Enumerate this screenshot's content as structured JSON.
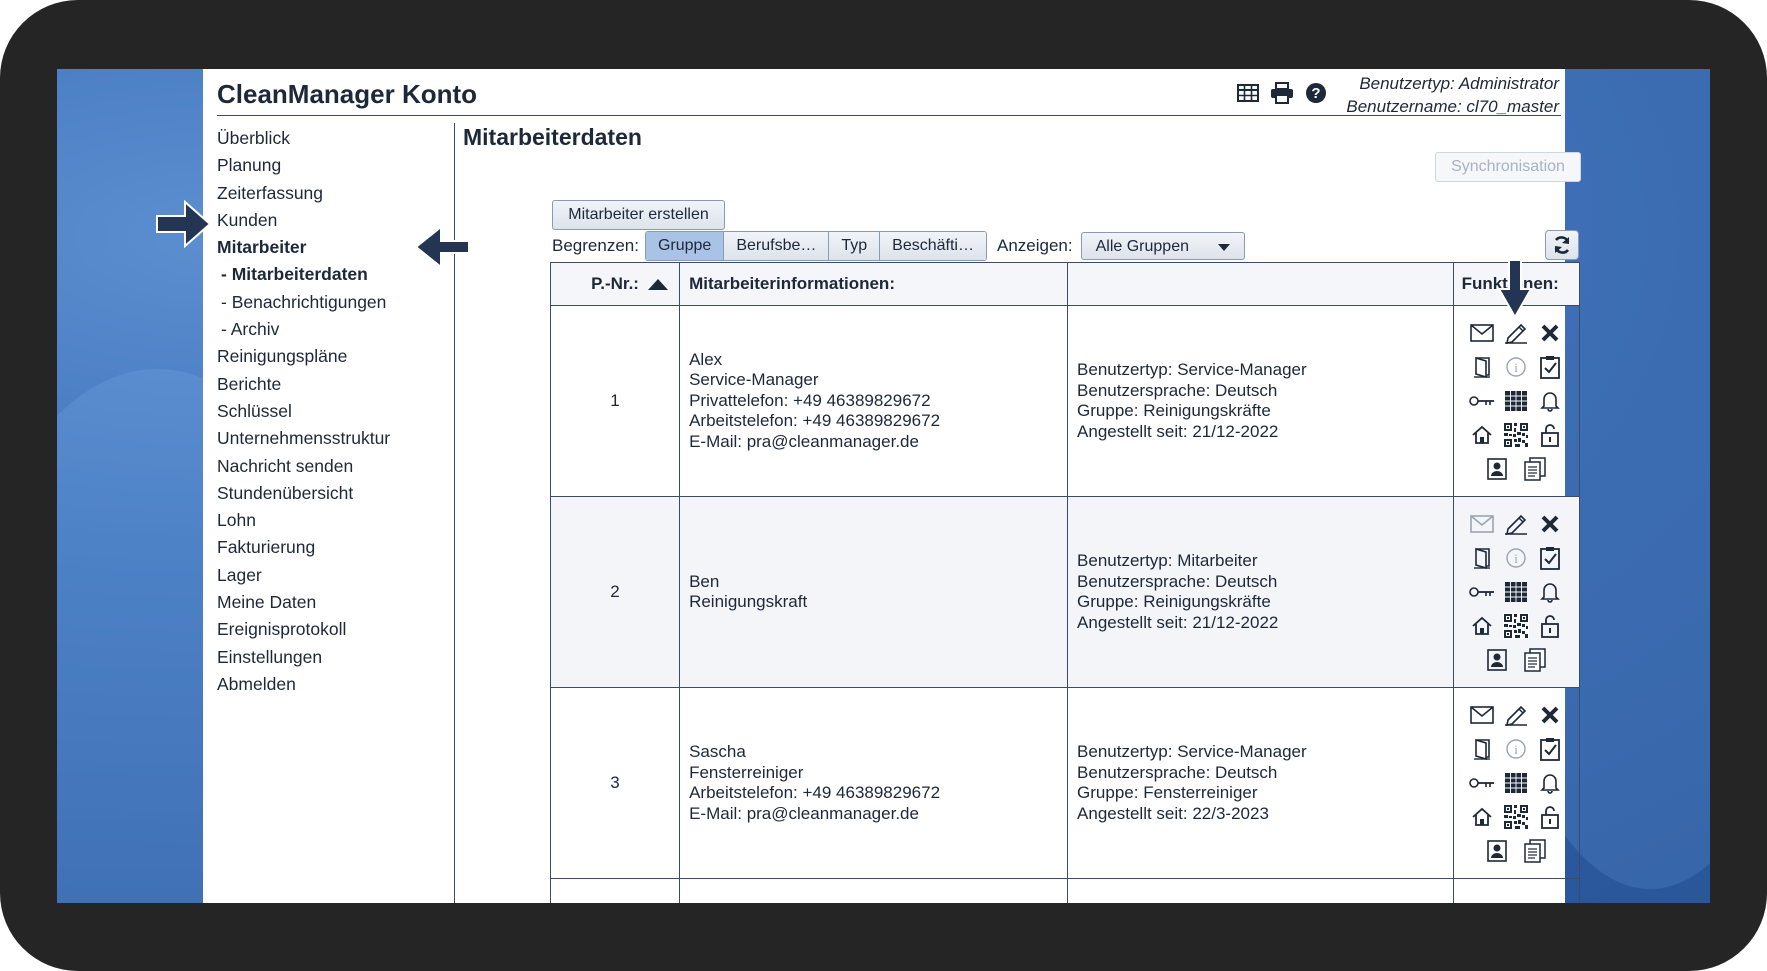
{
  "app": {
    "title": "CleanManager Konto",
    "user_type": "Benutzertyp: Administrator",
    "user_name": "Benutzername: cl70_master"
  },
  "header_icons": [
    "table-icon",
    "print-icon",
    "help-icon"
  ],
  "sidebar": {
    "items": [
      {
        "label": "Überblick",
        "bold": false,
        "sub": false
      },
      {
        "label": "Planung",
        "bold": false,
        "sub": false
      },
      {
        "label": "Zeiterfassung",
        "bold": false,
        "sub": false
      },
      {
        "label": "Kunden",
        "bold": false,
        "sub": false
      },
      {
        "label": "Mitarbeiter",
        "bold": true,
        "sub": false
      },
      {
        "label": "- Mitarbeiterdaten",
        "bold": true,
        "sub": true
      },
      {
        "label": "- Benachrichtigungen",
        "bold": false,
        "sub": true
      },
      {
        "label": "- Archiv",
        "bold": false,
        "sub": true
      },
      {
        "label": "Reinigungspläne",
        "bold": false,
        "sub": false
      },
      {
        "label": "Berichte",
        "bold": false,
        "sub": false
      },
      {
        "label": "Schlüssel",
        "bold": false,
        "sub": false
      },
      {
        "label": "Unternehmensstruktur",
        "bold": false,
        "sub": false
      },
      {
        "label": "Nachricht senden",
        "bold": false,
        "sub": false
      },
      {
        "label": "Stundenübersicht",
        "bold": false,
        "sub": false
      },
      {
        "label": "Lohn",
        "bold": false,
        "sub": false
      },
      {
        "label": "Fakturierung",
        "bold": false,
        "sub": false
      },
      {
        "label": "Lager",
        "bold": false,
        "sub": false
      },
      {
        "label": "Meine Daten",
        "bold": false,
        "sub": false
      },
      {
        "label": "Ereignisprotokoll",
        "bold": false,
        "sub": false
      },
      {
        "label": "Einstellungen",
        "bold": false,
        "sub": false
      },
      {
        "label": "Abmelden",
        "bold": false,
        "sub": false
      }
    ]
  },
  "main": {
    "title": "Mitarbeiterdaten",
    "sync_label": "Synchronisation",
    "create_label": "Mitarbeiter erstellen",
    "limit_label": "Begrenzen:",
    "limit_tabs": [
      {
        "label": "Gruppe",
        "active": true
      },
      {
        "label": "Berufsbe…",
        "active": false
      },
      {
        "label": "Typ",
        "active": false
      },
      {
        "label": "Beschäfti…",
        "active": false
      }
    ],
    "show_label": "Anzeigen:",
    "show_value": "Alle Gruppen"
  },
  "table": {
    "headers": {
      "pnr": "P.-Nr.:",
      "info": "Mitarbeiterinformationen:",
      "details": "",
      "functions": "Funktionen:"
    },
    "rows": [
      {
        "pnr": "1",
        "info": [
          "Alex",
          "Service-Manager",
          "Privattelefon: +49 46389829672",
          "Arbeitstelefon: +49 46389829672",
          "E-Mail: pra@cleanmanager.de"
        ],
        "details": [
          "Benutzertyp: Service-Manager",
          "Benutzersprache: Deutsch",
          "Gruppe: Reinigungskräfte",
          "Angestellt seit: 21/12-2022"
        ],
        "mail_active": true
      },
      {
        "pnr": "2",
        "info": [
          "Ben",
          "Reinigungskraft"
        ],
        "details": [
          "Benutzertyp: Mitarbeiter",
          "Benutzersprache: Deutsch",
          "Gruppe: Reinigungskräfte",
          "Angestellt seit: 21/12-2022"
        ],
        "mail_active": false
      },
      {
        "pnr": "3",
        "info": [
          "Sascha",
          "Fensterreiniger",
          "Arbeitstelefon: +49 46389829672",
          "E-Mail: pra@cleanmanager.de"
        ],
        "details": [
          "Benutzertyp: Service-Manager",
          "Benutzersprache: Deutsch",
          "Gruppe: Fensterreiniger",
          "Angestellt seit: 22/3-2023"
        ],
        "mail_active": true
      }
    ]
  },
  "function_icons": [
    "mail-icon",
    "edit-pencil-icon",
    "delete-x-icon",
    "door-icon",
    "info-icon",
    "checklist-icon",
    "key-icon",
    "calendar-grid-icon",
    "bell-icon",
    "home-icon",
    "qr-code-icon",
    "unlock-icon",
    "contact-card-icon",
    "documents-icon"
  ],
  "colors": {
    "primary_text": "#1d2838",
    "arrow": "#233553",
    "active_tab": "#a9c3e6",
    "desktop": "#3f73bb"
  }
}
